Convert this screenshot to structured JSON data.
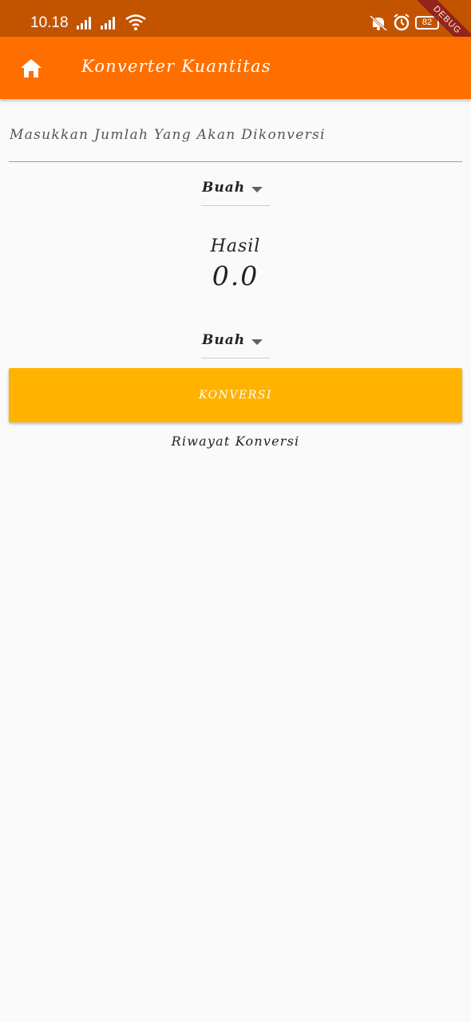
{
  "status_bar": {
    "time": "10.18",
    "battery": "82"
  },
  "debug_banner": "DEBUG",
  "app_bar": {
    "title": "Konverter Kuantitas",
    "accent_color": "#ff6f00"
  },
  "form": {
    "input_placeholder": "Masukkan Jumlah Yang Akan Dikonversi",
    "from_unit": "Buah",
    "result_label": "Hasil",
    "result_value": "0.0",
    "to_unit": "Buah",
    "convert_button": "KONVERSI",
    "convert_button_color": "#ffb300",
    "history_link": "Riwayat Konversi"
  }
}
